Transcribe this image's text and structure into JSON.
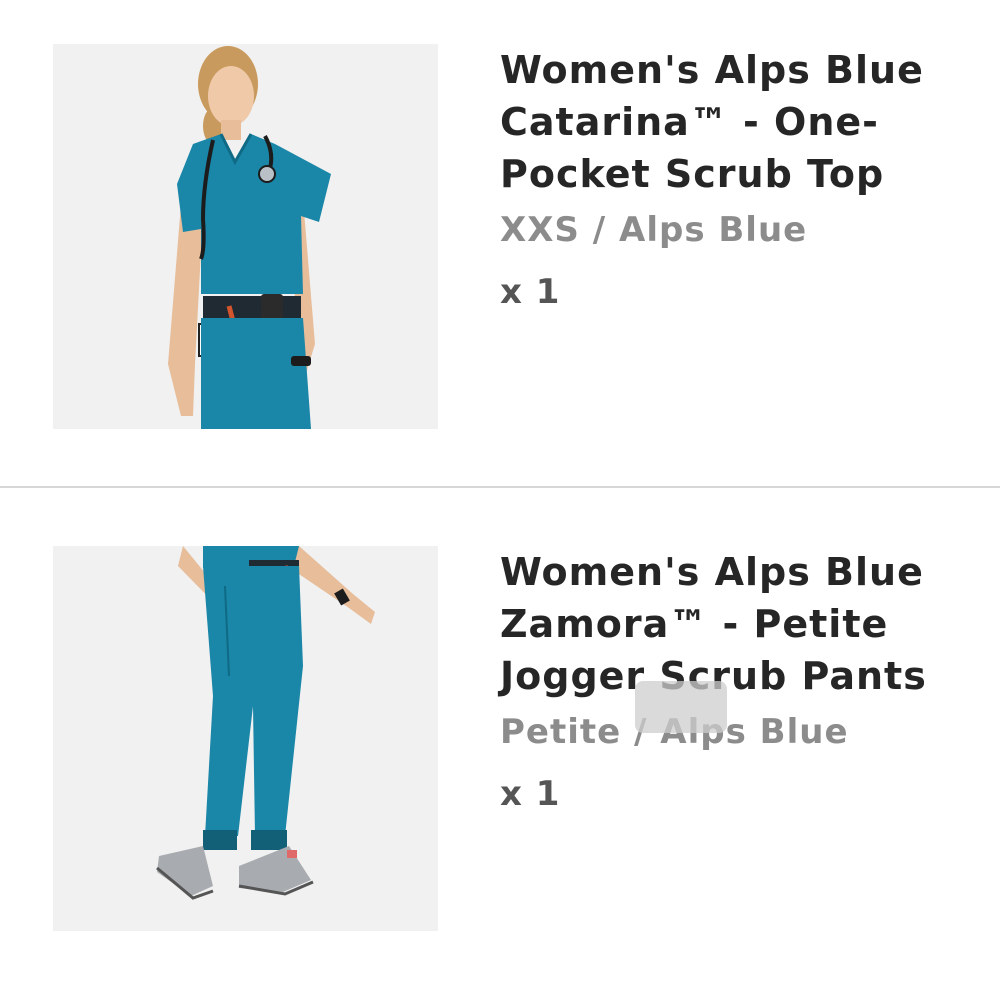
{
  "items": [
    {
      "image": "product-photo-scrub-top",
      "title_lines": [
        "Women's Alps Blue",
        "Catarina™ - One-",
        "Pocket Scrub Top"
      ],
      "variant": "XXS / Alps Blue",
      "quantity": "x 1"
    },
    {
      "image": "product-photo-jogger-pants",
      "title_lines": [
        "Women's Alps Blue",
        "Zamora™ - Petite",
        "Jogger Scrub Pants"
      ],
      "variant": "Petite / Alps Blue",
      "quantity": "x 1"
    }
  ],
  "colors": {
    "scrub_teal": "#1a86a8",
    "title_text": "#262626",
    "variant_text": "#8c8c8c",
    "divider": "#d6d6d6"
  }
}
